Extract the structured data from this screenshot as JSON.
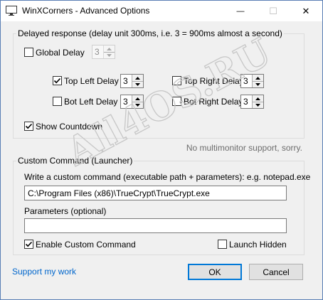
{
  "window": {
    "title": "WinXCorners - Advanced Options",
    "minimize_glyph": "—",
    "maximize_glyph": "☐",
    "close_glyph": "✕"
  },
  "delayed": {
    "group_label": "Delayed response (delay unit 300ms, i.e. 3 = 900ms almost a second)",
    "global_delay": {
      "label": "Global Delay",
      "checked": false,
      "value": "3",
      "enabled": false
    },
    "top_left": {
      "label": "Top Left Delay",
      "checked": true,
      "value": "3"
    },
    "top_right": {
      "label": "Top Right Delay",
      "checked": false,
      "value": "3"
    },
    "bot_left": {
      "label": "Bot Left Delay",
      "checked": false,
      "value": "3"
    },
    "bot_right": {
      "label": "Bot Right Delay",
      "checked": false,
      "value": "3"
    },
    "show_countdown": {
      "label": "Show Countdown",
      "checked": true
    }
  },
  "monitor_note": "No multimonitor support, sorry.",
  "custom": {
    "group_label": "Custom Command (Launcher)",
    "command_label": "Write a custom command (executable path + parameters): e.g. notepad.exe",
    "command_value": "C:\\Program Files (x86)\\TrueCrypt\\TrueCrypt.exe",
    "params_label": "Parameters (optional)",
    "params_value": "",
    "enable": {
      "label": "Enable Custom Command",
      "checked": true
    },
    "hidden": {
      "label": "Launch Hidden",
      "checked": false
    }
  },
  "footer": {
    "support_link": "Support my work",
    "ok_label": "OK",
    "cancel_label": "Cancel"
  },
  "watermark": "All4OS.RU",
  "colors": {
    "accent": "#0078d7",
    "link": "#0066cc",
    "watermark": "#c7c7c7"
  }
}
